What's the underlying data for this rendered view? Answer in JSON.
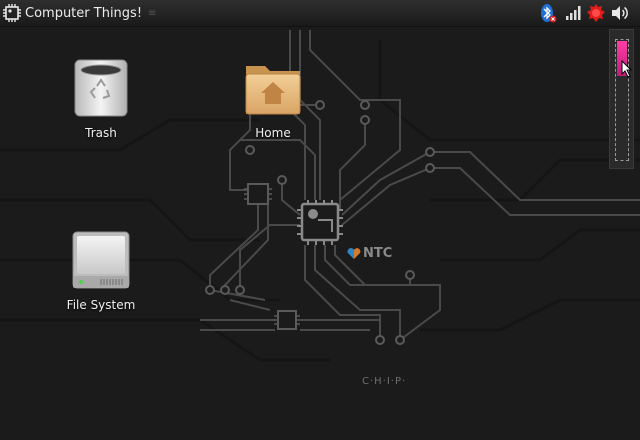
{
  "panel": {
    "title": "Computer Things!",
    "handle": "≡",
    "tray": [
      "bluetooth-icon",
      "signal-icon",
      "alert-icon",
      "volume-icon"
    ]
  },
  "desktop": {
    "icons": [
      {
        "label": "Trash",
        "icon": "trash-icon"
      },
      {
        "label": "Home",
        "icon": "home-folder-icon"
      },
      {
        "label": "File System",
        "icon": "drive-icon"
      }
    ]
  },
  "wallpaper": {
    "brand": "NTC",
    "product": "C·H·I·P·"
  },
  "colors": {
    "accent": "#e0238a",
    "panel": "#1f1f1f",
    "desktop": "#1b1b1b"
  }
}
